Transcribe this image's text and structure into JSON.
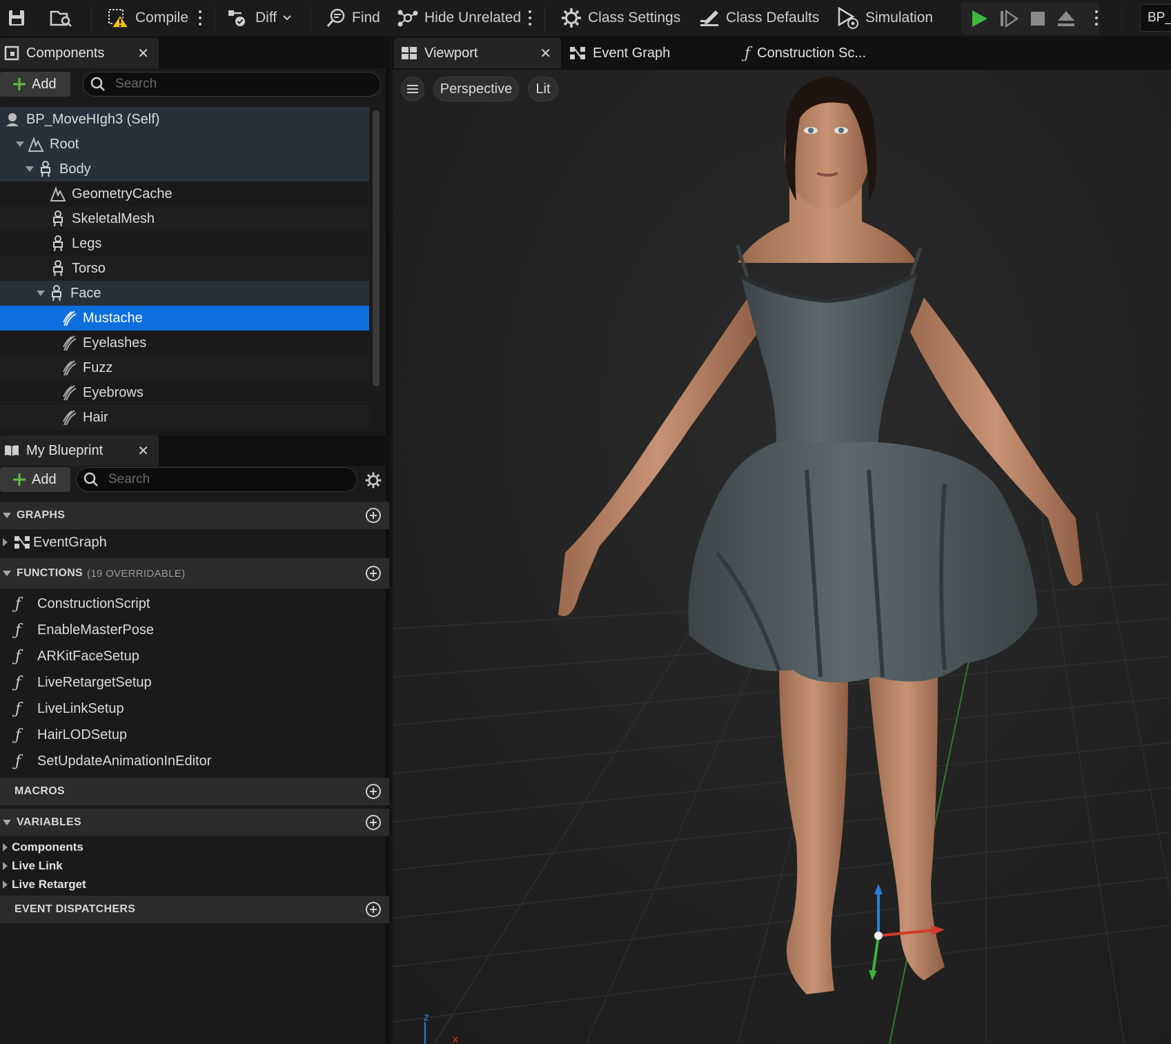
{
  "toolbar": {
    "compile": "Compile",
    "diff": "Diff",
    "find": "Find",
    "hide_unrelated": "Hide Unrelated",
    "class_settings": "Class Settings",
    "class_defaults": "Class Defaults",
    "simulation": "Simulation",
    "bp_tab": "BP_"
  },
  "components_panel": {
    "tab_label": "Components",
    "add_label": "Add",
    "search_placeholder": "Search",
    "tree": [
      {
        "label": "BP_MoveHIgh3 (Self)",
        "icon": "actor-icon"
      },
      {
        "label": "Root",
        "icon": "geometry-cache-icon"
      },
      {
        "label": "Body",
        "icon": "skeletal-mesh-icon"
      },
      {
        "label": "GeometryCache",
        "icon": "geometry-cache-icon"
      },
      {
        "label": "SkeletalMesh",
        "icon": "skeletal-mesh-icon"
      },
      {
        "label": "Legs",
        "icon": "skeletal-mesh-icon"
      },
      {
        "label": "Torso",
        "icon": "skeletal-mesh-icon"
      },
      {
        "label": "Face",
        "icon": "skeletal-mesh-icon"
      },
      {
        "label": "Mustache",
        "icon": "groom-icon"
      },
      {
        "label": "Eyelashes",
        "icon": "groom-icon"
      },
      {
        "label": "Fuzz",
        "icon": "groom-icon"
      },
      {
        "label": "Eyebrows",
        "icon": "groom-icon"
      },
      {
        "label": "Hair",
        "icon": "groom-icon"
      }
    ]
  },
  "my_blueprint": {
    "tab_label": "My Blueprint",
    "add_label": "Add",
    "search_placeholder": "Search",
    "graphs_label": "GRAPHS",
    "event_graph": "EventGraph",
    "functions_label": "FUNCTIONS",
    "functions_sub": "(19 OVERRIDABLE)",
    "functions": [
      "ConstructionScript",
      "EnableMasterPose",
      "ARKitFaceSetup",
      "LiveRetargetSetup",
      "LiveLinkSetup",
      "HairLODSetup",
      "SetUpdateAnimationInEditor"
    ],
    "macros_label": "MACROS",
    "variables_label": "VARIABLES",
    "variables": [
      "Components",
      "Live Link",
      "Live Retarget"
    ],
    "dispatchers_label": "EVENT DISPATCHERS"
  },
  "viewport": {
    "tabs": [
      "Viewport",
      "Event Graph",
      "Construction Sc..."
    ],
    "perspective": "Perspective",
    "lit": "Lit"
  },
  "colors": {
    "selection": "#0d6fdd",
    "play": "#3fb73f",
    "accent_axis_z": "#2f7de0",
    "accent_axis_x": "#d23a2a",
    "accent_axis_y": "#3cb23c"
  }
}
